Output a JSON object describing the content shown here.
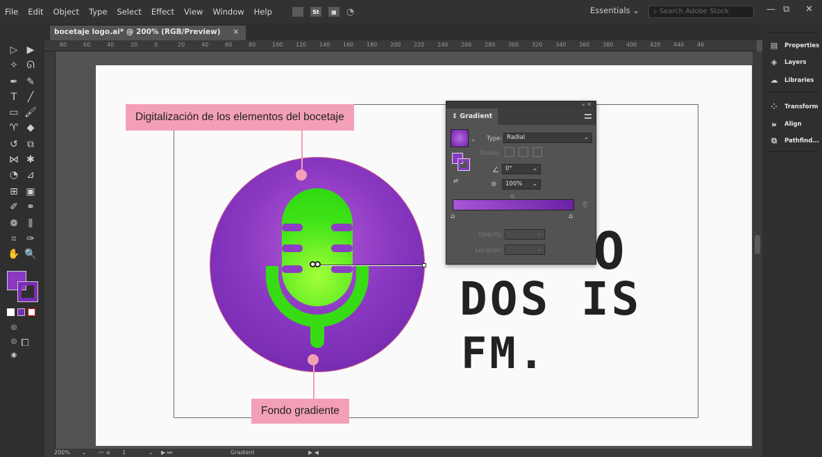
{
  "menubar": {
    "items": [
      "File",
      "Edit",
      "Object",
      "Type",
      "Select",
      "Effect",
      "View",
      "Window",
      "Help"
    ],
    "icon_labels": [
      "St"
    ],
    "workspace": "Essentials",
    "search_placeholder": "Search Adobe Stock",
    "window_controls": [
      "—",
      "⧉",
      "✕"
    ]
  },
  "document": {
    "tab_title": "bocetaje logo.ai* @ 200% (RGB/Preview)",
    "tab_close": "×"
  },
  "ruler": {
    "ticks": [
      "80",
      "60",
      "40",
      "20",
      "0",
      "20",
      "40",
      "60",
      "80",
      "100",
      "120",
      "140",
      "160",
      "180",
      "200",
      "220",
      "240",
      "260",
      "280",
      "300",
      "320",
      "340",
      "360",
      "380",
      "400",
      "420",
      "440",
      "46"
    ]
  },
  "annotations": {
    "top": "Digitalización de los elementos del bocetaje",
    "bottom": "Fondo gradiente"
  },
  "sketch_text": {
    "line1": "O",
    "line2": "DOS IS",
    "line3": "FM."
  },
  "gradient_panel": {
    "title": "Gradient",
    "type_label": "Type:",
    "type_value": "Radial",
    "stroke_label": "Stroke:",
    "angle_value": "0°",
    "aspect_value": "100%",
    "opacity_label": "Opacity:",
    "location_label": "Location:",
    "colors": {
      "start": "#a855d8",
      "end": "#6a22a6"
    }
  },
  "right_panels": [
    "Properties",
    "Layers",
    "Libraries",
    "Transform",
    "Align",
    "Pathfind..."
  ],
  "status": {
    "zoom": "200%",
    "artboard": "1",
    "tool": "Gradient"
  },
  "colors": {
    "accent_purple": "#8a38c1",
    "mic_green": "#37dc15",
    "callout_pink": "#f3a0b6"
  }
}
